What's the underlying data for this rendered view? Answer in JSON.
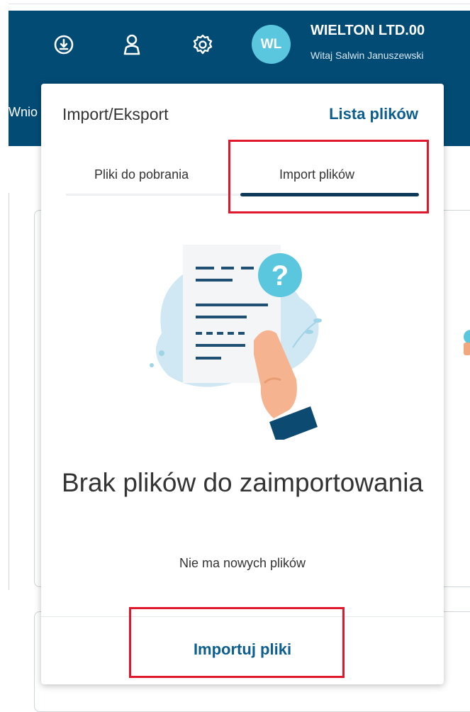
{
  "header": {
    "company": "WIELTON LTD.00",
    "greeting": "Witaj Salwin Januszewski",
    "avatar_initials": "WL",
    "nav_partial": "Wnio",
    "icons": [
      "download-icon",
      "user-icon",
      "gear-icon"
    ]
  },
  "panel": {
    "title": "Import/Eksport",
    "link": "Lista plików",
    "tabs": [
      {
        "label": "Pliki do pobrania",
        "active": false
      },
      {
        "label": "Import plików",
        "active": true
      }
    ],
    "empty_title": "Brak plików do zaimportowania",
    "empty_subtitle": "Nie ma nowych plików",
    "import_button": "Importuj pliki"
  },
  "colors": {
    "topbar": "#024b75",
    "avatar": "#5ac7de",
    "link": "#0b5e8e",
    "highlight": "#e0182d"
  }
}
